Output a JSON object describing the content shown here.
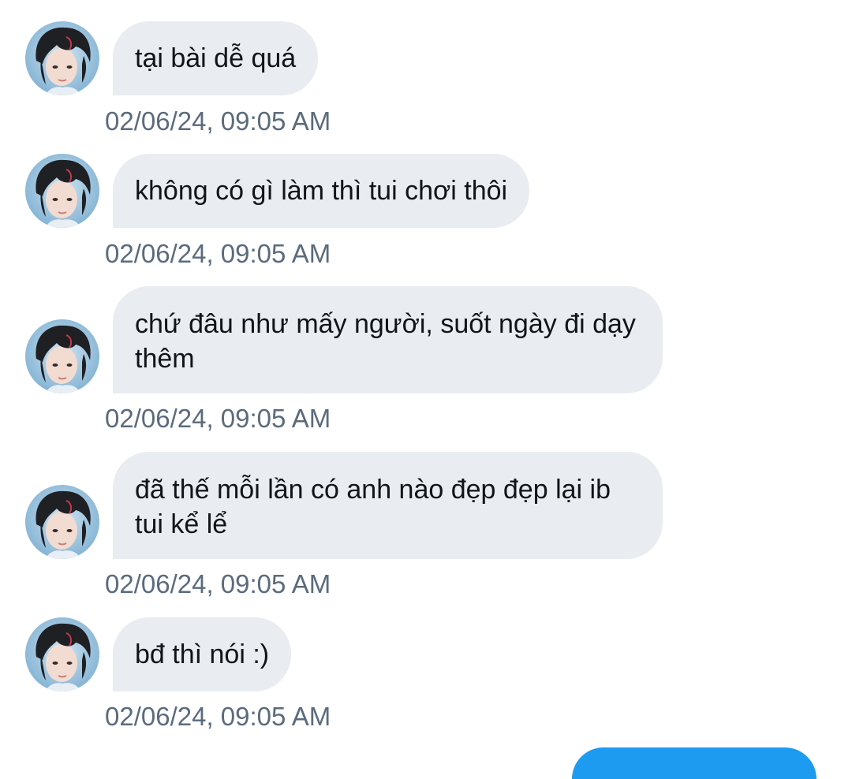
{
  "conversation": {
    "messages": [
      {
        "text": "tại bài dễ quá",
        "timestamp": "02/06/24, 09:05 AM"
      },
      {
        "text": "không có gì làm thì tui chơi thôi",
        "timestamp": "02/06/24, 09:05 AM"
      },
      {
        "text": "chứ đâu như mấy người, suốt ngày đi dạy thêm",
        "timestamp": "02/06/24, 09:05 AM"
      },
      {
        "text": "đã thế mỗi lần có anh nào đẹp đẹp lại ib tui kể lể",
        "timestamp": "02/06/24, 09:05 AM"
      },
      {
        "text": "bđ thì nói :)",
        "timestamp": "02/06/24, 09:05 AM"
      }
    ]
  },
  "colors": {
    "received_bubble": "#e9ecf0",
    "timestamp_text": "#5b6b7d",
    "sent_bubble": "#1d9bf0"
  }
}
